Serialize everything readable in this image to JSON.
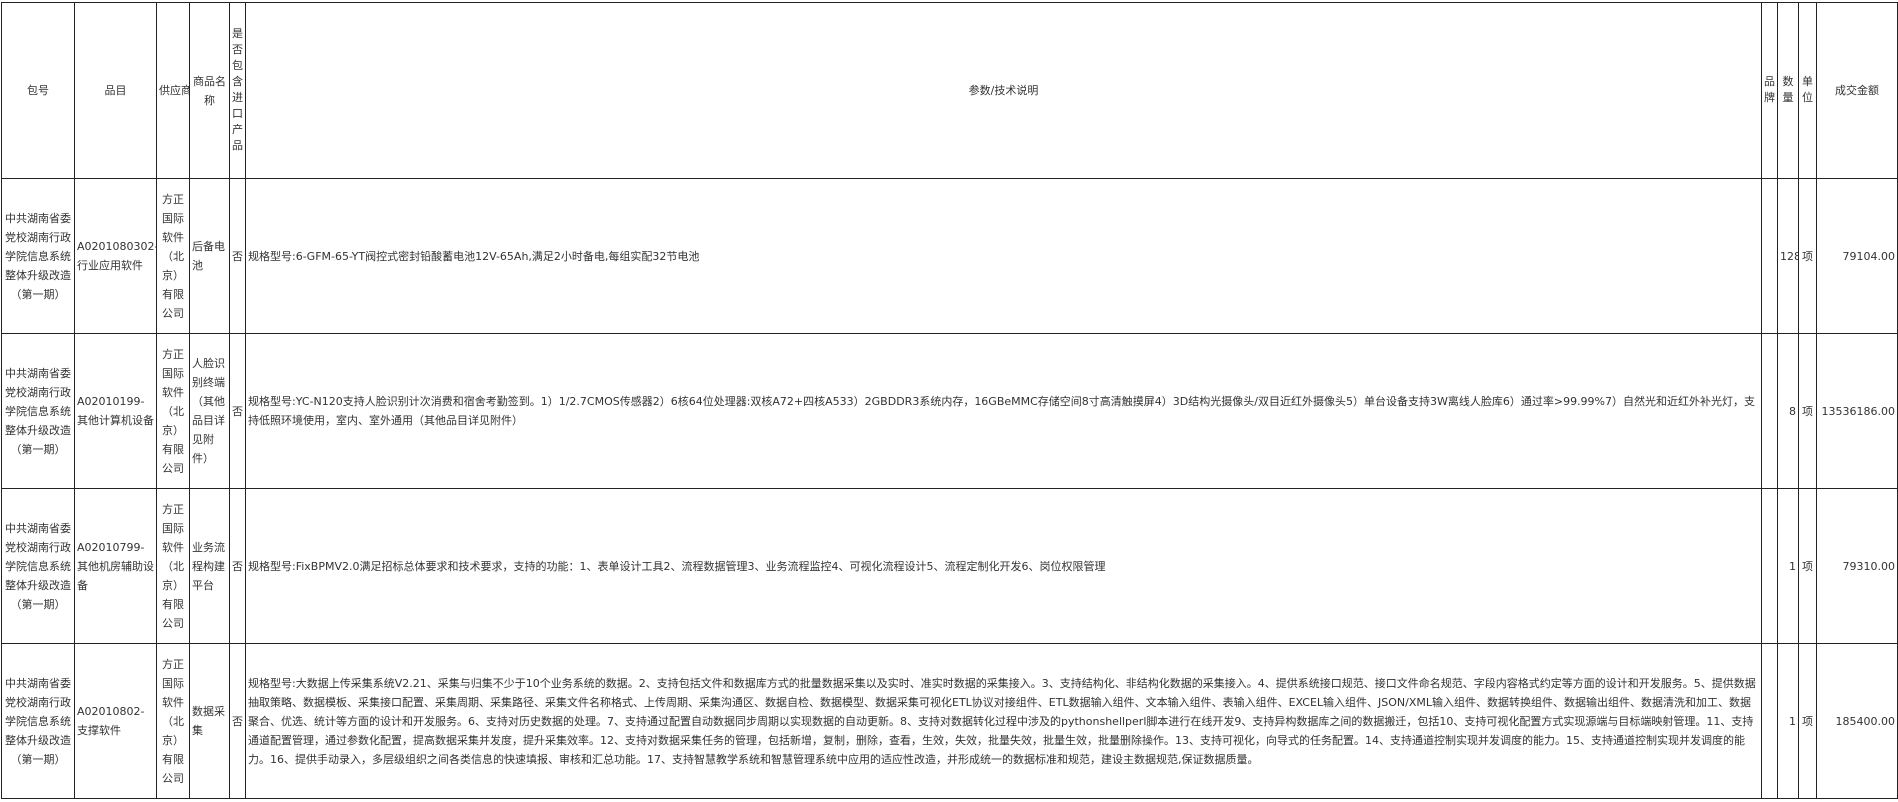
{
  "headers": {
    "package": "包号",
    "item": "品目",
    "supplier": "供应商",
    "product_name": "商品名称",
    "import": "是否包含进口产品",
    "spec": "参数/技术说明",
    "brand": "品牌",
    "quantity": "数量",
    "unit": "单位",
    "amount": "成交金额"
  },
  "rows": [
    {
      "package": "中共湖南省委党校湖南行政学院信息系统整体升级改造（第一期）",
      "item": "A0201080302-行业应用软件",
      "supplier": "方正国际软件（北京）有限公司",
      "product_name": "后备电池",
      "import": "否",
      "spec": "规格型号:6-GFM-65-YT阀控式密封铅酸蓄电池12V-65Ah,满足2小时备电,每组实配32节电池",
      "brand": "",
      "quantity": "128",
      "unit": "项",
      "amount": "79104.00"
    },
    {
      "package": "中共湖南省委党校湖南行政学院信息系统整体升级改造（第一期）",
      "item": "A02010199-其他计算机设备",
      "supplier": "方正国际软件（北京）有限公司",
      "product_name": "人脸识别终端（其他品目详见附件）",
      "import": "否",
      "spec": "规格型号:YC-N120支持人脸识别计次消费和宿舍考勤签到。1）1/2.7CMOS传感器2）6核64位处理器:双核A72+四核A533）2GBDDR3系统内存，16GBeMMC存储空间8寸高清触摸屏4）3D结构光摄像头/双目近红外摄像头5）单台设备支持3W离线人脸库6）通过率>99.99%7）自然光和近红外补光灯，支持低照环境使用，室内、室外通用（其他品目详见附件）",
      "brand": "",
      "quantity": "8",
      "unit": "项",
      "amount": "13536186.00"
    },
    {
      "package": "中共湖南省委党校湖南行政学院信息系统整体升级改造（第一期）",
      "item": "A02010799-其他机房辅助设备",
      "supplier": "方正国际软件（北京）有限公司",
      "product_name": "业务流程构建平台",
      "import": "否",
      "spec": "规格型号:FixBPMV2.0满足招标总体要求和技术要求，支持的功能：1、表单设计工具2、流程数据管理3、业务流程监控4、可视化流程设计5、流程定制化开发6、岗位权限管理",
      "brand": "",
      "quantity": "1",
      "unit": "项",
      "amount": "79310.00"
    },
    {
      "package": "中共湖南省委党校湖南行政学院信息系统整体升级改造（第一期）",
      "item": "A02010802-支撑软件",
      "supplier": "方正国际软件（北京）有限公司",
      "product_name": "数据采集",
      "import": "否",
      "spec": "规格型号:大数据上传采集系统V2.21、采集与归集不少于10个业务系统的数据。2、支持包括文件和数据库方式的批量数据采集以及实时、准实时数据的采集接入。3、支持结构化、非结构化数据的采集接入。4、提供系统接口规范、接口文件命名规范、字段内容格式约定等方面的设计和开发服务。5、提供数据抽取策略、数据模板、采集接口配置、采集周期、采集路径、采集文件名称格式、上传周期、采集沟通区、数据自检、数据模型、数据采集可视化ETL协议对接组件、ETL数据输入组件、文本输入组件、表输入组件、EXCEL输入组件、JSON/XML输入组件、数据转换组件、数据输出组件、数据清洗和加工、数据聚合、优选、统计等方面的设计和开发服务。6、支持对历史数据的处理。7、支持通过配置自动数据同步周期以实现数据的自动更新。8、支持对数据转化过程中涉及的pythonshellperl脚本进行在线开发9、支持异构数据库之间的数据搬迁，包括10、支持可视化配置方式实现源端与目标端映射管理。11、支持通道配置管理，通过参数化配置，提高数据采集并发度，提升采集效率。12、支持对数据采集任务的管理，包括新增，复制，删除，查看，生效，失效，批量失效，批量生效，批量删除操作。13、支持可视化，向导式的任务配置。14、支持通道控制实现并发调度的能力。15、支持通道控制实现并发调度的能力。16、提供手动录入，多层级组织之间各类信息的快速填报、审核和汇总功能。17、支持智慧教学系统和智慧管理系统中应用的适应性改造，并形成统一的数据标准和规范，建设主数据规范,保证数据质量。",
      "brand": "",
      "quantity": "1",
      "unit": "项",
      "amount": "185400.00"
    }
  ]
}
